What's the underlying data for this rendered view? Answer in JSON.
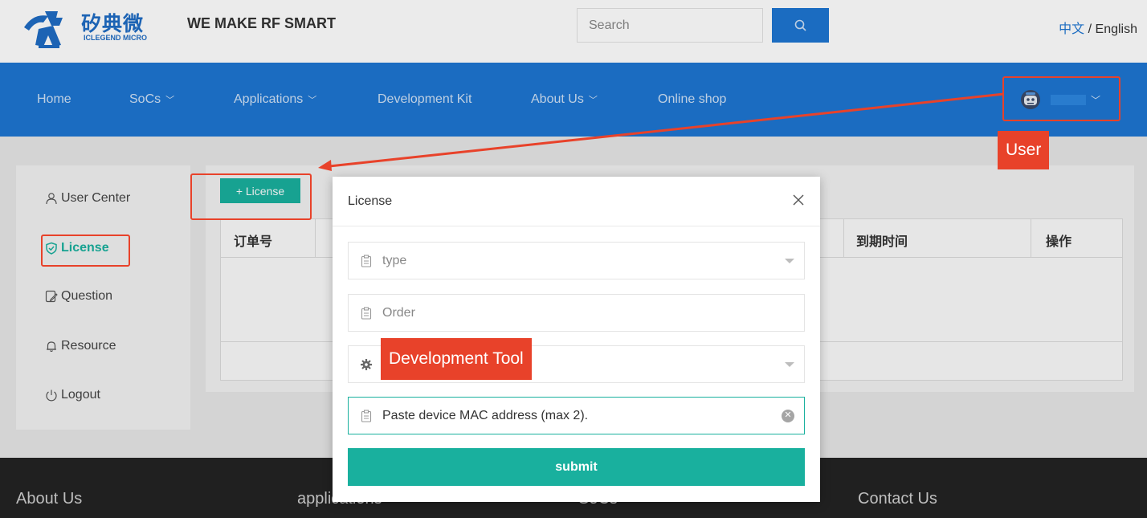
{
  "header": {
    "logo_cn": "矽典微",
    "logo_en": "ICLEGEND MICRO",
    "slogan": "WE MAKE RF SMART",
    "search_placeholder": "Search",
    "lang_cn": "中文",
    "lang_sep": " / ",
    "lang_en": "English"
  },
  "nav": {
    "items": [
      {
        "label": "Home",
        "has_dropdown": false
      },
      {
        "label": "SoCs",
        "has_dropdown": true
      },
      {
        "label": "Applications",
        "has_dropdown": true
      },
      {
        "label": "Development Kit",
        "has_dropdown": false
      },
      {
        "label": "About Us",
        "has_dropdown": true
      },
      {
        "label": "Online shop",
        "has_dropdown": false
      }
    ],
    "user_icon": "robot-avatar-icon"
  },
  "sidebar": {
    "items": [
      {
        "label": "User Center",
        "icon": "user-icon"
      },
      {
        "label": "License",
        "icon": "shield-check-icon",
        "active": true
      },
      {
        "label": "Question",
        "icon": "edit-note-icon"
      },
      {
        "label": "Resource",
        "icon": "bell-icon"
      },
      {
        "label": "Logout",
        "icon": "power-icon"
      }
    ]
  },
  "main": {
    "add_button_label": "+ License",
    "table": {
      "columns": [
        "订单号",
        "到期时间",
        "操作"
      ]
    }
  },
  "modal": {
    "title": "License",
    "type_placeholder": "type",
    "order_placeholder": "Order",
    "mac_value": "Paste device MAC address (max 2).",
    "submit_label": "submit"
  },
  "footer": {
    "items": [
      "About Us",
      "applications",
      "SoCs",
      "Contact Us"
    ]
  },
  "annotations": {
    "user_label": "User",
    "dev_tool_label": "Development Tool",
    "color": "#e8422a"
  },
  "colors": {
    "brand_blue": "#1e76d2",
    "accent_teal": "#19b09e",
    "footer_dark": "#232323"
  }
}
